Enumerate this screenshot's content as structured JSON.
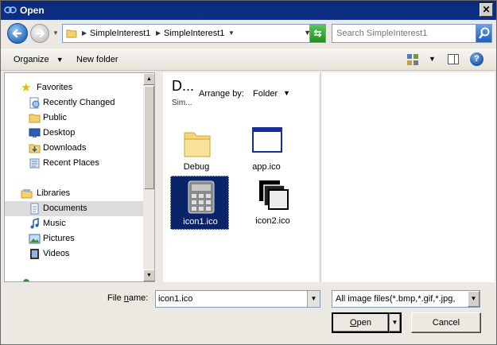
{
  "window": {
    "title": "Open"
  },
  "address": {
    "crumbs": [
      "SimpleInterest1",
      "SimpleInterest1"
    ]
  },
  "search": {
    "placeholder": "Search SimpleInterest1"
  },
  "toolbar": {
    "organize": "Organize",
    "new_folder": "New folder"
  },
  "nav": {
    "favorites_label": "Favorites",
    "favorites": [
      "Recently Changed",
      "Public",
      "Desktop",
      "Downloads",
      "Recent Places"
    ],
    "libraries_label": "Libraries",
    "libraries": [
      "Documents",
      "Music",
      "Pictures",
      "Videos"
    ],
    "selected": "Documents"
  },
  "filepane": {
    "title": "D...",
    "subtitle": "Sim...",
    "arrange_label": "Arrange by:",
    "arrange_value": "Folder",
    "items": [
      "Debug",
      "app.ico",
      "icon1.ico",
      "icon2.ico"
    ],
    "selected": "icon1.ico"
  },
  "bottom": {
    "file_name_label_pre": "File ",
    "file_name_label_u": "n",
    "file_name_label_post": "ame:",
    "file_name_value": "icon1.ico",
    "file_type": "All image files(*.bmp,*.gif,*.jpg,",
    "open_label_u": "O",
    "open_label_rest": "pen",
    "cancel_label": "Cancel"
  },
  "colors": {
    "titlebar": "#0b2a7a",
    "selection": "#0a246a"
  }
}
